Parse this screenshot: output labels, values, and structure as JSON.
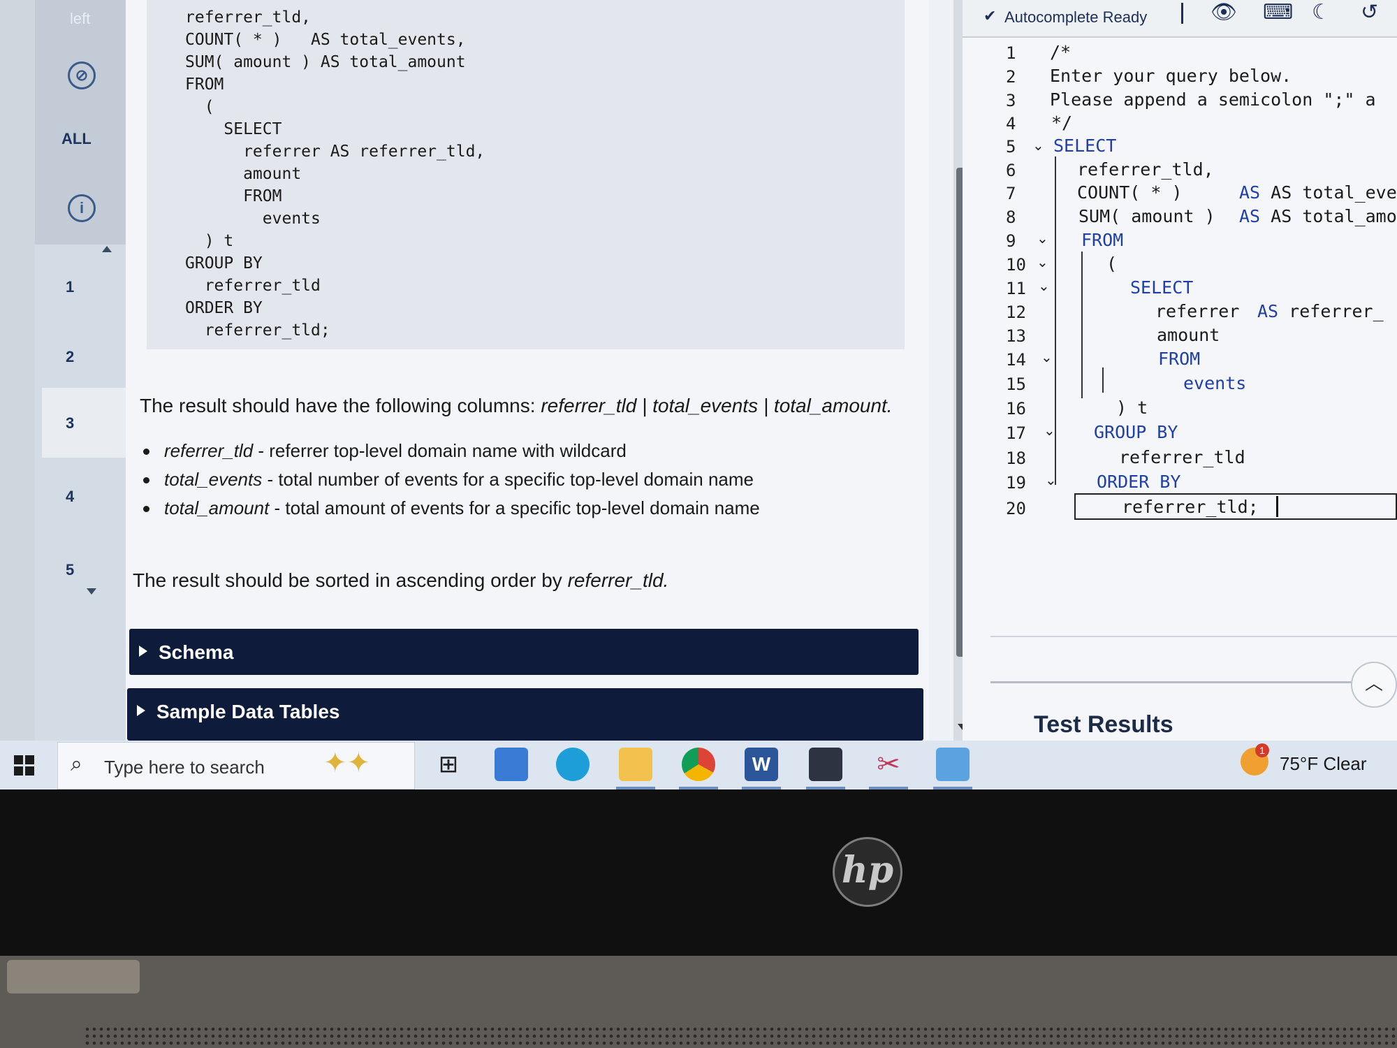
{
  "nav": {
    "top_label": "left",
    "all_label": "ALL",
    "questions": [
      "1",
      "2",
      "3",
      "4",
      "5"
    ],
    "active_question": "3"
  },
  "problem": {
    "code_lines": [
      "referrer_tld,",
      "COUNT( * )   AS total_events,",
      "SUM( amount ) AS total_amount",
      "FROM",
      "  (",
      "    SELECT",
      "      referrer AS referrer_tld,",
      "      amount",
      "      FROM",
      "        events",
      "  ) t",
      "GROUP BY",
      "  referrer_tld",
      "ORDER BY",
      "  referrer_tld;"
    ],
    "columns_intro": "The result should have the following columns: ",
    "columns_list": "referrer_tld | total_events | total_amount.",
    "bullets": [
      {
        "term": "referrer_tld",
        "desc": " - referrer top-level domain name with wildcard"
      },
      {
        "term": "total_events",
        "desc": " - total number of events for a specific top-level domain name"
      },
      {
        "term": "total_amount",
        "desc": " - total amount of events for a specific top-level domain name"
      }
    ],
    "sort_intro": "The result should be sorted in ascending order by ",
    "sort_field": "referrer_tld.",
    "schema_label": "Schema",
    "sample_label": "Sample Data Tables"
  },
  "editor": {
    "status": "Autocomplete Ready",
    "line_numbers": [
      "1",
      "2",
      "3",
      "4",
      "5",
      "6",
      "7",
      "8",
      "9",
      "10",
      "11",
      "12",
      "13",
      "14",
      "15",
      "16",
      "17",
      "18",
      "19",
      "20"
    ],
    "lines": [
      "/*",
      "Enter your query below.",
      "Please append a semicolon \";\" a",
      "*/",
      "SELECT",
      "referrer_tld,",
      "COUNT( * )",
      "SUM( amount )",
      "FROM",
      "(",
      "SELECT",
      "referrer",
      "amount",
      "FROM",
      "events",
      ") t",
      "GROUP BY",
      "referrer_tld",
      "ORDER BY",
      "referrer_tld;"
    ],
    "alias_7": "AS total_event",
    "alias_8": "AS total_amoun",
    "alias_12_kw": "AS",
    "alias_12": "referrer_",
    "test_results_label": "Test Results"
  },
  "taskbar": {
    "search_placeholder": "Type here to search",
    "weather": "75°F  Clear",
    "weather_badge": "1"
  },
  "bezel": {
    "logo": "hp"
  }
}
